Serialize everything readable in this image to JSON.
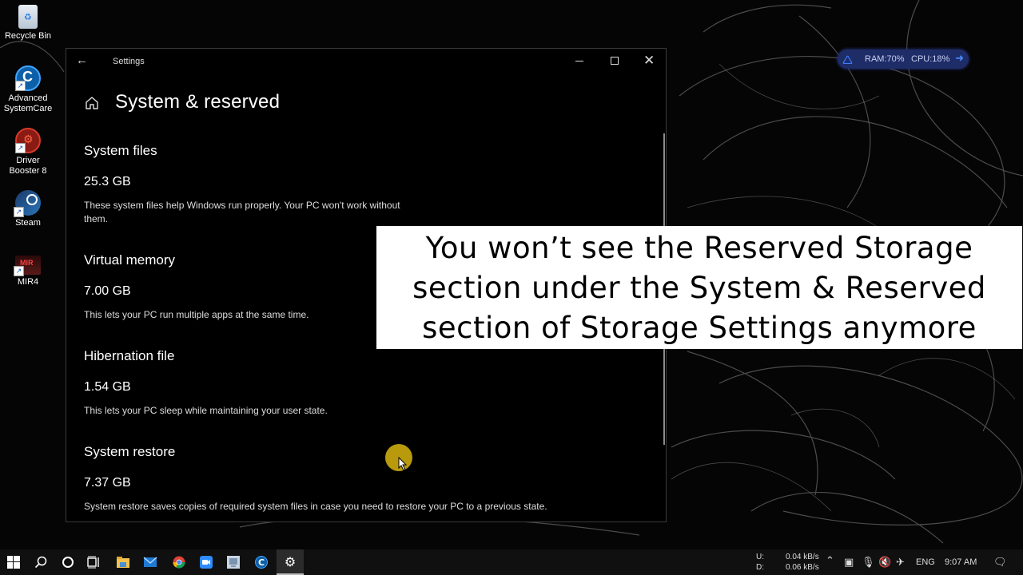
{
  "desktop": {
    "icons": [
      {
        "label": "Recycle Bin",
        "icon": "recycle-bin-icon"
      },
      {
        "label": "Advanced SystemCare",
        "icon": "advanced-systemcare-icon"
      },
      {
        "label": "Driver Booster 8",
        "icon": "driver-booster-icon"
      },
      {
        "label": "Steam",
        "icon": "steam-icon"
      },
      {
        "label": "MIR4",
        "icon": "mir4-icon"
      }
    ]
  },
  "window": {
    "title": "Settings",
    "back_icon": "←",
    "page_title": "System & reserved",
    "sections": [
      {
        "heading": "System files",
        "size": "25.3 GB",
        "description": "These system files help Windows run properly. Your PC won't work without them."
      },
      {
        "heading": "Virtual memory",
        "size": "7.00 GB",
        "description": "This lets your PC run multiple apps at the same time."
      },
      {
        "heading": "Hibernation file",
        "size": "1.54 GB",
        "description": "This lets your PC sleep while maintaining your user state."
      },
      {
        "heading": "System restore",
        "size": "7.37 GB",
        "description": "System restore saves copies of required system files in case you need to restore your PC to a previous state."
      }
    ]
  },
  "caption": {
    "lines": [
      "You won’t see the Reserved Storage",
      "section under the System & Reserved",
      "section of Storage Settings anymore"
    ]
  },
  "perf_widget": {
    "ram": "RAM:70%",
    "cpu": "CPU:18%",
    "accent": "#1e2c68"
  },
  "taskbar": {
    "apps": [
      "start",
      "search",
      "cortana",
      "task-view",
      "file-explorer",
      "mail",
      "chrome",
      "zoom",
      "remote-desktop",
      "advanced-systemcare",
      "settings"
    ],
    "active_app": "settings",
    "net_upload_label": "U:",
    "net_download_label": "D:",
    "net_upload": "0.04 kB/s",
    "net_download": "0.06 kB/s",
    "language": "ENG",
    "time": "9:07 AM"
  }
}
